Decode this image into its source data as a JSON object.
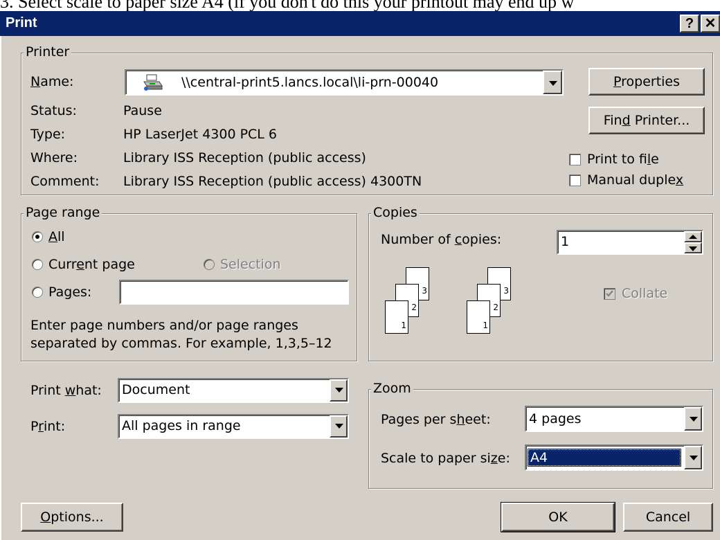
{
  "caption": "3.  Select scale to paper size A4 (if you don't do this your printout may end up w",
  "window": {
    "title": "Print",
    "help_glyph": "?",
    "close_glyph": "✕"
  },
  "printer": {
    "group_label": "Printer",
    "name_label_u": "N",
    "name_label_rest": "ame:",
    "name_value": "\\\\central-print5.lancs.local\\li-prn-00040",
    "status_label": "Status:",
    "status_value": "Pause",
    "type_label": "Type:",
    "type_value": "HP LaserJet 4300 PCL 6",
    "where_label": "Where:",
    "where_value": "Library ISS Reception (public access)",
    "comment_label": "Comment:",
    "comment_value": "Library ISS Reception (public access) 4300TN",
    "properties_u": "P",
    "properties_rest": "roperties",
    "find_pre": "Fin",
    "find_u": "d",
    "find_rest": " Printer...",
    "print_to_file_pre": "Print to fi",
    "print_to_file_u": "l",
    "print_to_file_rest": "e",
    "manual_duplex_pre": "Manual duple",
    "manual_duplex_u": "x",
    "manual_duplex_rest": ""
  },
  "page_range": {
    "group_label": "Page range",
    "all_u": "A",
    "all_rest": "ll",
    "current_pre": "Curr",
    "current_u": "e",
    "current_rest": "nt page",
    "selection": "Selection",
    "pages_pre": "Pa",
    "pages_u": "g",
    "pages_rest": "es:",
    "pages_value": "",
    "hint_line1": "Enter page numbers and/or page ranges",
    "hint_line2": "separated by commas.  For example, 1,3,5–12"
  },
  "copies": {
    "group_label": "Copies",
    "number_pre": "Number of ",
    "number_u": "c",
    "number_rest": "opies:",
    "number_value": "1",
    "collate_label": "Collate",
    "stack_numbers": [
      "3",
      "2",
      "1"
    ]
  },
  "print_what": {
    "label_pre": "Print ",
    "label_u": "w",
    "label_rest": "hat:",
    "value": "Document"
  },
  "print": {
    "label_pre": "P",
    "label_u": "r",
    "label_rest": "int:",
    "value": "All pages in range"
  },
  "zoom": {
    "group_label": "Zoom",
    "pps_pre": "Pages per s",
    "pps_u": "h",
    "pps_rest": "eet:",
    "pps_value": "4 pages",
    "scale_pre": "Scale to paper si",
    "scale_u": "z",
    "scale_rest": "e:",
    "scale_value": "A4"
  },
  "buttons": {
    "options_u": "O",
    "options_rest": "ptions...",
    "ok": "OK",
    "cancel": "Cancel"
  },
  "colors": {
    "titlebar": "#0a246a",
    "face": "#d4d0c8",
    "selection": "#0a246a"
  }
}
